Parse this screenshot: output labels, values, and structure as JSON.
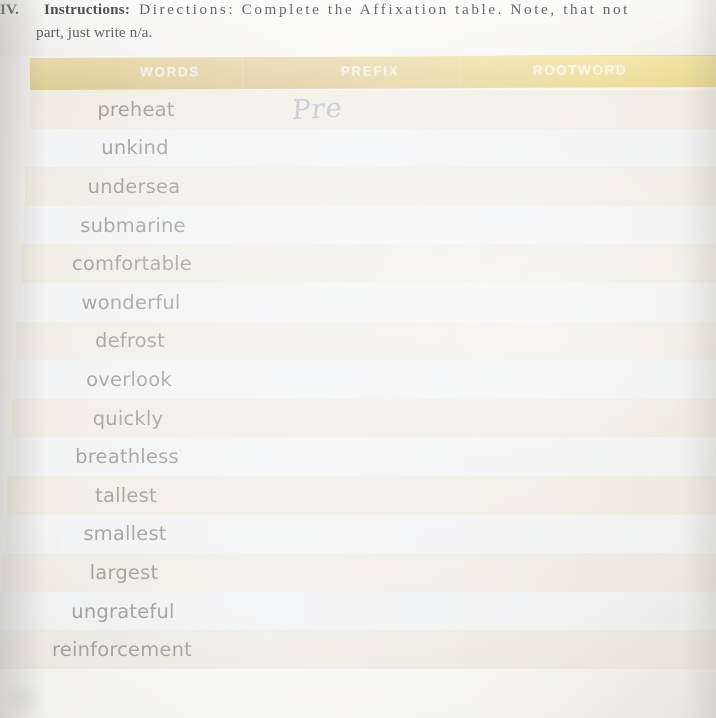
{
  "worksheet": {
    "numeral": "IV.",
    "instructions_label": "Instructions:",
    "instructions_line_1": "Directions:  Complete  the  Affixation  table.  Note,  that  not",
    "instructions_line_2": "part, just write n/a."
  },
  "table": {
    "headers": {
      "words": "WORDS",
      "prefix": "PREFIX",
      "rootword": "ROOTWORD"
    },
    "rows": [
      {
        "word": "preheat",
        "prefix": "Pre",
        "rootword": ""
      },
      {
        "word": "unkind",
        "prefix": "",
        "rootword": ""
      },
      {
        "word": "undersea",
        "prefix": "",
        "rootword": ""
      },
      {
        "word": "submarine",
        "prefix": "",
        "rootword": ""
      },
      {
        "word": "comfortable",
        "prefix": "",
        "rootword": ""
      },
      {
        "word": "wonderful",
        "prefix": "",
        "rootword": ""
      },
      {
        "word": "defrost",
        "prefix": "",
        "rootword": ""
      },
      {
        "word": "overlook",
        "prefix": "",
        "rootword": ""
      },
      {
        "word": "quickly",
        "prefix": "",
        "rootword": ""
      },
      {
        "word": "breathless",
        "prefix": "",
        "rootword": ""
      },
      {
        "word": "tallest",
        "prefix": "",
        "rootword": ""
      },
      {
        "word": "smallest",
        "prefix": "",
        "rootword": ""
      },
      {
        "word": "largest",
        "prefix": "",
        "rootword": ""
      },
      {
        "word": "ungrateful",
        "prefix": "",
        "rootword": ""
      },
      {
        "word": "reinforcement",
        "prefix": "",
        "rootword": ""
      }
    ]
  },
  "colors": {
    "header_gold_left": "#cdab4d",
    "header_gold_right": "#e9c746",
    "header_text": "#f4f1e6",
    "row_beige": "#e7e1d2",
    "row_cool": "#e9eaec",
    "word_text": "#55534f",
    "handwriting_ink": "#707f9f",
    "instruction_text": "#5a5f63"
  }
}
